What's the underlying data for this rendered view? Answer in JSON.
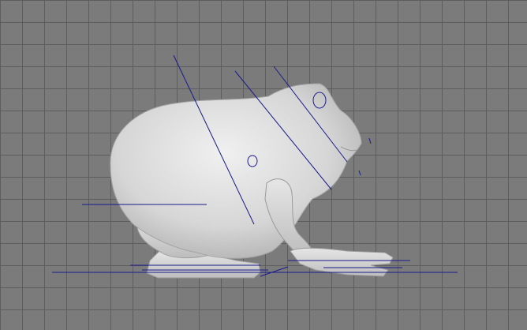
{
  "viewport": {
    "grid_color": "#5d5d5d",
    "background_color": "#7b7b7b",
    "model_color": "#d8d8d8",
    "rig_line_color": "#1a1a8c"
  },
  "scene": {
    "model": "frog-mesh",
    "rig": "joint-lines"
  }
}
